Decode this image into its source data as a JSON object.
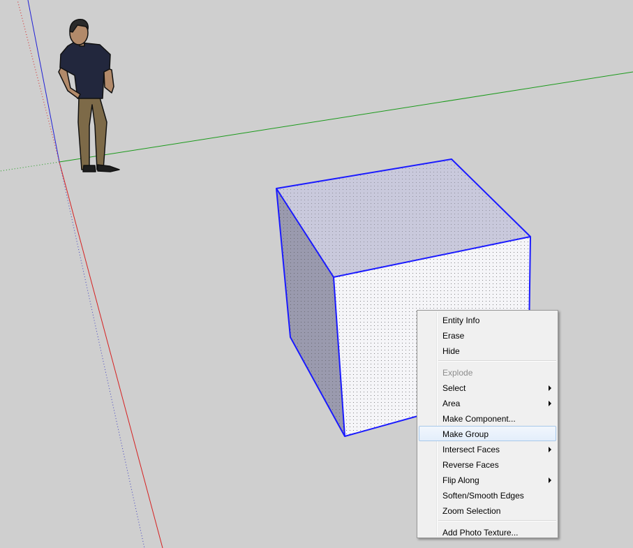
{
  "scene": {
    "axis_colors": {
      "red": "#d62020",
      "green": "#1a9a1a",
      "blue": "#1a1ad6"
    },
    "selection_color": "#1a1aff",
    "background": "#cfcfcf"
  },
  "context_menu": {
    "items": [
      {
        "label": "Entity Info",
        "enabled": true,
        "submenu": false
      },
      {
        "label": "Erase",
        "enabled": true,
        "submenu": false
      },
      {
        "label": "Hide",
        "enabled": true,
        "submenu": false
      },
      {
        "separator": true
      },
      {
        "label": "Explode",
        "enabled": false,
        "submenu": false
      },
      {
        "label": "Select",
        "enabled": true,
        "submenu": true
      },
      {
        "label": "Area",
        "enabled": true,
        "submenu": true
      },
      {
        "label": "Make Component...",
        "enabled": true,
        "submenu": false
      },
      {
        "label": "Make Group",
        "enabled": true,
        "submenu": false,
        "hovered": true
      },
      {
        "label": "Intersect Faces",
        "enabled": true,
        "submenu": true
      },
      {
        "label": "Reverse Faces",
        "enabled": true,
        "submenu": false
      },
      {
        "label": "Flip Along",
        "enabled": true,
        "submenu": true
      },
      {
        "label": "Soften/Smooth Edges",
        "enabled": true,
        "submenu": false
      },
      {
        "label": "Zoom Selection",
        "enabled": true,
        "submenu": false
      },
      {
        "separator": true
      },
      {
        "label": "Add Photo Texture...",
        "enabled": true,
        "submenu": false
      }
    ]
  }
}
